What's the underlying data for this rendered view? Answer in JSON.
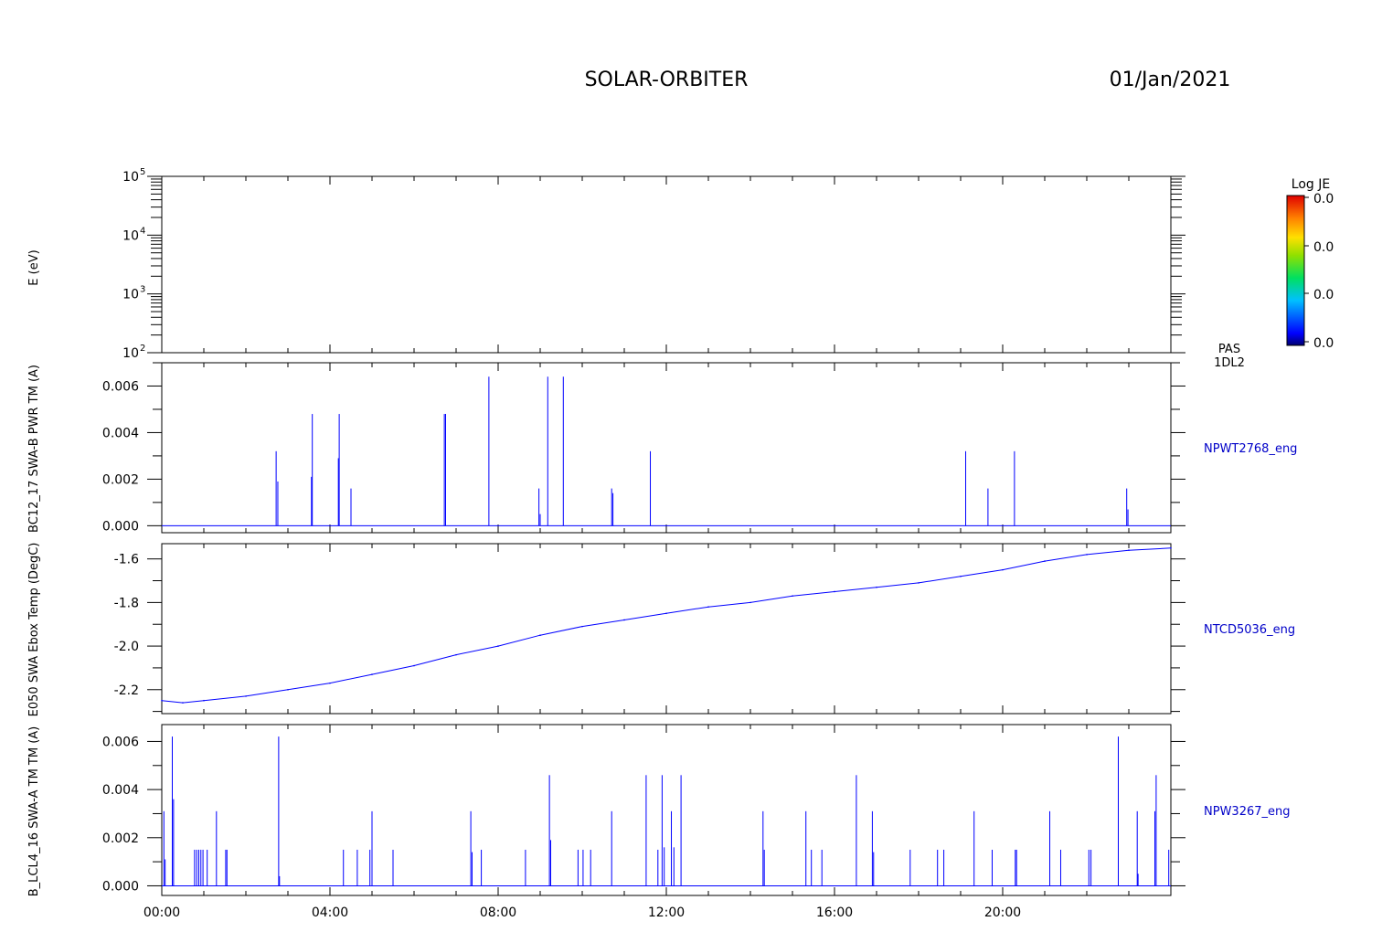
{
  "header": {
    "mission": "SOLAR-ORBITER",
    "date": "01/Jan/2021"
  },
  "x_axis": {
    "ticks": [
      "00:00",
      "04:00",
      "08:00",
      "12:00",
      "16:00",
      "20:00"
    ],
    "range_hours": [
      0,
      24
    ]
  },
  "colorbar": {
    "title": "Log JE",
    "labels": [
      "0.0",
      "0.0",
      "0.0",
      "0.0"
    ]
  },
  "colors": {
    "trace": "#0000ff",
    "axes": "#000000",
    "label_blue": "#0000c8"
  },
  "chart_data": [
    {
      "type": "heatmap",
      "ylabel": "E (eV)",
      "yscale": "log",
      "ylim": [
        100,
        100000
      ],
      "y_tick_labels": [
        "10^2",
        "10^3",
        "10^4",
        "10^5"
      ],
      "side_label": [
        "PAS",
        "1DL2"
      ],
      "values": []
    },
    {
      "type": "line",
      "ylabel": "BC12_17 SWA-B PWR TM (A)",
      "series_label": "NPWT2768_eng",
      "ylim": [
        -0.0003,
        0.007
      ],
      "y_ticks": [
        "0.000",
        "0.002",
        "0.004",
        "0.006"
      ],
      "baseline": 0.0,
      "spikes": [
        [
          2.72,
          0.0032
        ],
        [
          2.76,
          0.0019
        ],
        [
          3.58,
          0.0048
        ],
        [
          3.56,
          0.0021
        ],
        [
          4.22,
          0.0048
        ],
        [
          4.2,
          0.0029
        ],
        [
          4.5,
          0.0016
        ],
        [
          6.72,
          0.0048
        ],
        [
          6.75,
          0.0048
        ],
        [
          7.78,
          0.0064
        ],
        [
          8.97,
          0.0016
        ],
        [
          9.0,
          0.0005
        ],
        [
          9.18,
          0.0064
        ],
        [
          9.55,
          0.0064
        ],
        [
          10.7,
          0.0016
        ],
        [
          10.73,
          0.0014
        ],
        [
          11.62,
          0.0032
        ],
        [
          19.12,
          0.0032
        ],
        [
          19.65,
          0.0016
        ],
        [
          20.28,
          0.0032
        ],
        [
          22.95,
          0.0016
        ],
        [
          22.98,
          0.0007
        ]
      ]
    },
    {
      "type": "line",
      "ylabel": "E050 SWA Ebox Temp (DegC)",
      "series_label": "NTCD5036_eng",
      "ylim": [
        -2.31,
        -1.53
      ],
      "y_ticks": [
        "-1.6",
        "-1.8",
        "-2.0",
        "-2.2"
      ],
      "x": [
        0,
        0.5,
        1,
        2,
        3,
        4,
        5,
        6,
        7,
        8,
        9,
        10,
        11,
        12,
        13,
        14,
        15,
        16,
        17,
        18,
        19,
        20,
        21,
        22,
        23,
        24
      ],
      "values": [
        -2.25,
        -2.26,
        -2.25,
        -2.23,
        -2.2,
        -2.17,
        -2.13,
        -2.09,
        -2.04,
        -2.0,
        -1.95,
        -1.91,
        -1.88,
        -1.85,
        -1.82,
        -1.8,
        -1.77,
        -1.75,
        -1.73,
        -1.71,
        -1.68,
        -1.65,
        -1.61,
        -1.58,
        -1.56,
        -1.55
      ]
    },
    {
      "type": "line",
      "ylabel": "B_LCL4_16 SWA-A TM TM (A)",
      "series_label": "NPW3267_eng",
      "ylim": [
        -0.0004,
        0.0067
      ],
      "y_ticks": [
        "0.000",
        "0.002",
        "0.004",
        "0.006"
      ],
      "baseline": 0.0,
      "spikes": [
        [
          0.05,
          0.0031
        ],
        [
          0.08,
          0.0011
        ],
        [
          0.25,
          0.0062
        ],
        [
          0.28,
          0.0036
        ],
        [
          0.78,
          0.0015
        ],
        [
          0.83,
          0.0015
        ],
        [
          0.88,
          0.0015
        ],
        [
          0.93,
          0.0015
        ],
        [
          0.98,
          0.0015
        ],
        [
          1.08,
          0.0015
        ],
        [
          1.3,
          0.0031
        ],
        [
          1.52,
          0.0015
        ],
        [
          1.55,
          0.0015
        ],
        [
          2.78,
          0.0062
        ],
        [
          2.8,
          0.0004
        ],
        [
          4.32,
          0.0015
        ],
        [
          4.65,
          0.0015
        ],
        [
          4.95,
          0.0015
        ],
        [
          5.0,
          0.0031
        ],
        [
          5.5,
          0.0015
        ],
        [
          7.35,
          0.0031
        ],
        [
          7.38,
          0.0014
        ],
        [
          7.6,
          0.0015
        ],
        [
          8.65,
          0.0015
        ],
        [
          9.22,
          0.0046
        ],
        [
          9.25,
          0.0019
        ],
        [
          9.9,
          0.0015
        ],
        [
          10.02,
          0.0015
        ],
        [
          10.2,
          0.0015
        ],
        [
          10.7,
          0.0031
        ],
        [
          11.52,
          0.0046
        ],
        [
          11.8,
          0.0015
        ],
        [
          11.9,
          0.0046
        ],
        [
          11.95,
          0.0016
        ],
        [
          12.12,
          0.0031
        ],
        [
          12.18,
          0.0016
        ],
        [
          12.35,
          0.0046
        ],
        [
          14.3,
          0.0031
        ],
        [
          14.33,
          0.0015
        ],
        [
          15.32,
          0.0031
        ],
        [
          15.45,
          0.0015
        ],
        [
          15.7,
          0.0015
        ],
        [
          16.52,
          0.0046
        ],
        [
          16.9,
          0.0031
        ],
        [
          16.93,
          0.0014
        ],
        [
          17.8,
          0.0015
        ],
        [
          18.45,
          0.0015
        ],
        [
          18.6,
          0.0015
        ],
        [
          19.32,
          0.0031
        ],
        [
          19.75,
          0.0015
        ],
        [
          20.3,
          0.0015
        ],
        [
          20.33,
          0.0015
        ],
        [
          21.12,
          0.0031
        ],
        [
          21.38,
          0.0015
        ],
        [
          22.05,
          0.0015
        ],
        [
          22.1,
          0.0015
        ],
        [
          22.75,
          0.0062
        ],
        [
          23.2,
          0.0031
        ],
        [
          23.22,
          0.0005
        ],
        [
          23.65,
          0.0046
        ],
        [
          23.62,
          0.0031
        ],
        [
          23.95,
          0.0015
        ]
      ]
    }
  ]
}
